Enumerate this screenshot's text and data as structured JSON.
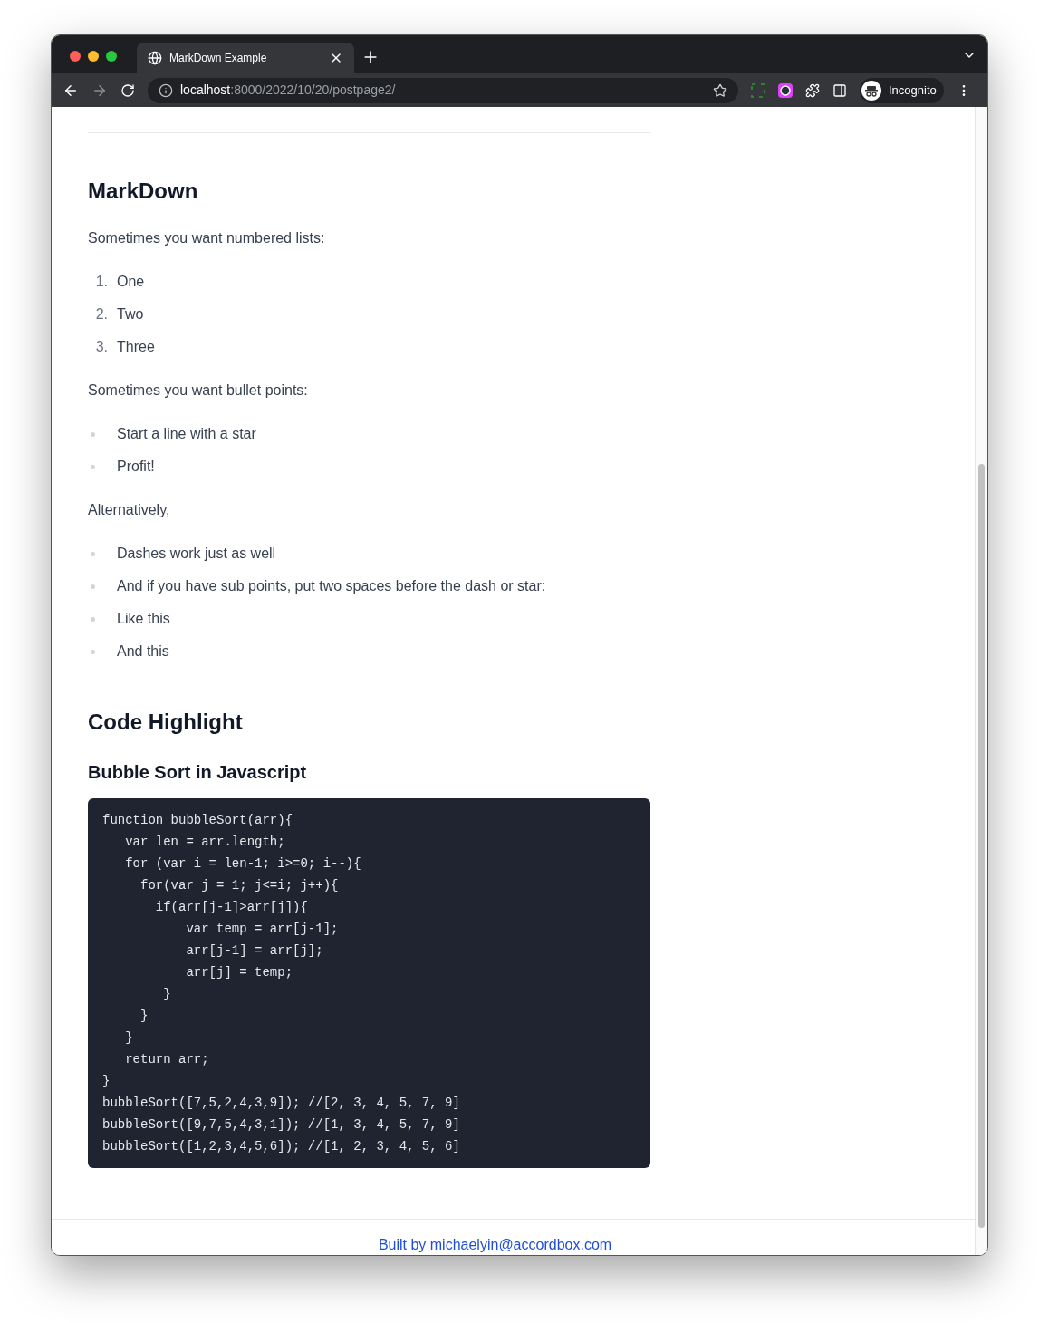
{
  "browser": {
    "tab_title": "MarkDown Example",
    "url_host": "localhost",
    "url_path": ":8000/2022/10/20/postpage2/",
    "profile_label": "Incognito"
  },
  "article": [
    {
      "kind": "heading2",
      "text": "MarkDown"
    },
    {
      "kind": "paragraph",
      "text": "Sometimes you want numbered lists:"
    },
    {
      "kind": "ordered_list",
      "items": [
        {
          "marker": "1.",
          "text": "One"
        },
        {
          "marker": "2.",
          "text": "Two"
        },
        {
          "marker": "3.",
          "text": "Three"
        }
      ]
    },
    {
      "kind": "paragraph",
      "text": "Sometimes you want bullet points:"
    },
    {
      "kind": "bullet_list",
      "items": [
        {
          "text": "Start a line with a star"
        },
        {
          "text": "Profit!"
        }
      ]
    },
    {
      "kind": "paragraph",
      "text": "Alternatively,"
    },
    {
      "kind": "bullet_list",
      "items": [
        {
          "text": "Dashes work just as well"
        },
        {
          "text": "And if you have sub points, put two spaces before the dash or star:"
        },
        {
          "text": "Like this"
        },
        {
          "text": "And this"
        }
      ]
    },
    {
      "kind": "heading2",
      "text": "Code Highlight"
    },
    {
      "kind": "heading3",
      "text": "Bubble Sort in Javascript"
    },
    {
      "kind": "code",
      "lines": [
        "function bubbleSort(arr){",
        "   var len = arr.length;",
        "   for (var i = len-1; i>=0; i--){",
        "     for(var j = 1; j<=i; j++){",
        "       if(arr[j-1]>arr[j]){",
        "           var temp = arr[j-1];",
        "           arr[j-1] = arr[j];",
        "           arr[j] = temp;",
        "        }",
        "     }",
        "   }",
        "   return arr;",
        "}",
        "bubbleSort([7,5,2,4,3,9]); //[2, 3, 4, 5, 7, 9]",
        "bubbleSort([9,7,5,4,3,1]); //[1, 3, 4, 5, 7, 9]",
        "bubbleSort([1,2,3,4,5,6]); //[1, 2, 3, 4, 5, 6]"
      ]
    }
  ],
  "footer": {
    "link": "Built by michaelyin@accordbox.com"
  }
}
